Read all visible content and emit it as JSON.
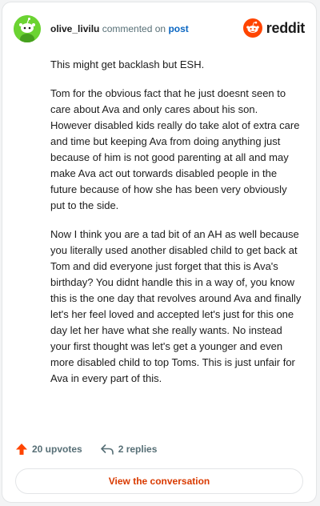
{
  "comment": {
    "username": "olive_livilu",
    "action_text": "commented on",
    "post_link": "post",
    "paragraphs": [
      "This might get backlash but ESH.",
      "Tom for the obvious fact that he just doesnt seen to care about Ava and only cares about his son. However disabled kids really do take alot of extra care and time but keeping Ava from doing anything just because of him is not good parenting at all and may make Ava act out torwards disabled people in the future because of how she has been very obviously put to the side.",
      "Now I think you are a tad bit of an AH as well because you literally used another disabled child to get back at Tom and did everyone just forget that this is Ava's birthday? You didnt handle this in a way of, you know this is the one day that revolves around Ava and finally let's her feel loved and accepted let's just for this one day let her have what she really wants. No instead your first thought was let's get a younger and even more disabled child to top Toms. This is just unfair for Ava in every part of this."
    ]
  },
  "brand": {
    "wordmark": "reddit",
    "logo_icon": "reddit-snoo-icon",
    "accent_color": "#ff4500"
  },
  "footer": {
    "upvotes": "20 upvotes",
    "replies": "2 replies",
    "upvote_color": "#ff4500"
  },
  "cta": {
    "label": "View the conversation",
    "color": "#d93a00"
  }
}
